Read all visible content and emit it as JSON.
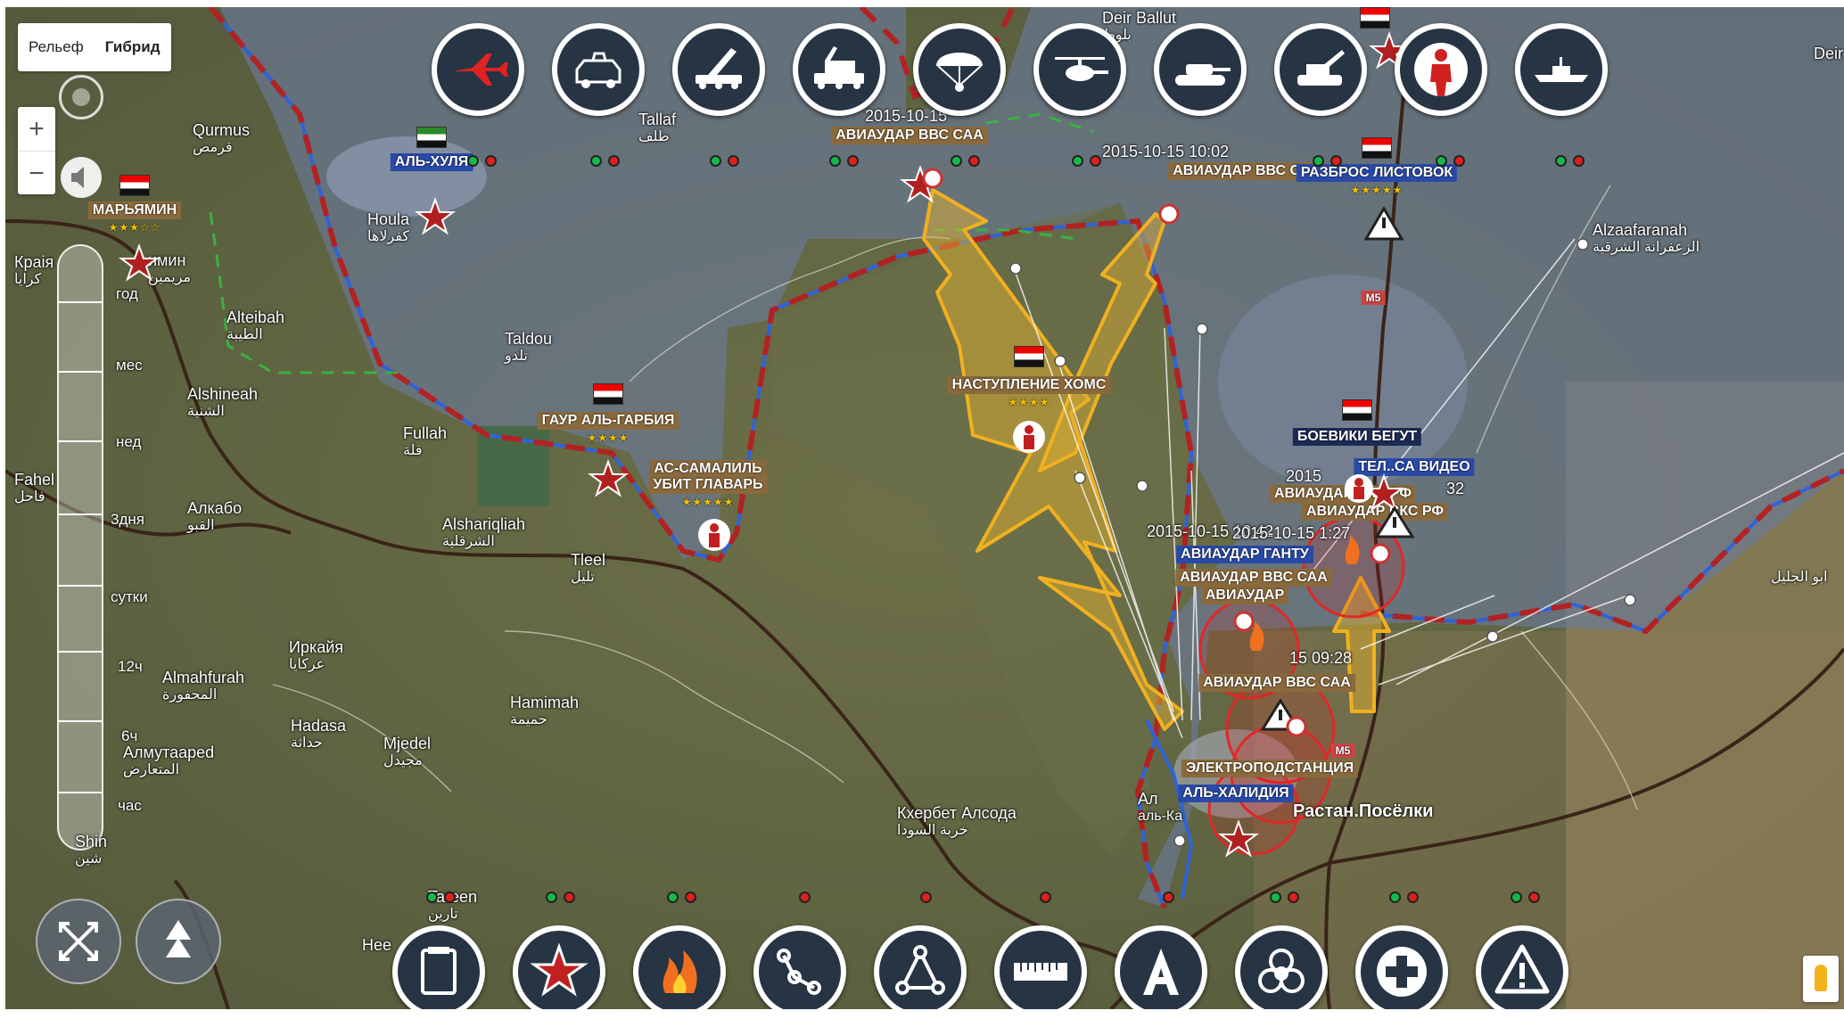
{
  "maptype": {
    "relief": "Рельеф",
    "hybrid": "Гибрид"
  },
  "zoom": {
    "in": "+",
    "out": "−"
  },
  "timeline": {
    "labels": [
      "год",
      "мес",
      "нед",
      "3дня",
      "сутки",
      "12ч",
      "6ч",
      "час"
    ]
  },
  "toolbar_top": [
    "jet-icon",
    "armored-car-icon",
    "rocket-launcher-icon",
    "mlrs-icon",
    "paratrooper-icon",
    "helicopter-icon",
    "tank-icon",
    "artillery-icon",
    "infantry-icon",
    "warship-icon"
  ],
  "toolbar_bottom": [
    "note-icon",
    "star-icon",
    "fire-icon",
    "route-icon",
    "triangle-route-icon",
    "ruler-icon",
    "text-icon",
    "biohazard-icon",
    "medical-cross-icon",
    "warning-icon"
  ],
  "colors": {
    "front_red": "#b22222",
    "front_blue": "#2f63d6",
    "advance": "#f0b020",
    "syria_red": "#e00000",
    "toolbar_bg": "#263444"
  },
  "markers": {
    "marjamin": "МАРЬЯМИН",
    "al_hula": "АЛЬ-ХУЛЯ",
    "gaur": "ГАУР АЛЬ-ГАРБИЯ",
    "samalil": "АС-САМАЛИЛЬ",
    "samalil2": "УБИТ ГЛАВАРЬ",
    "airstrike1": "АВИАУДАР ВВС САА",
    "airstrike2": "АВИАУДАР ВВС САА",
    "offensive": "НАСТУПЛЕНИЕ ХОМС",
    "leaflets": "РАЗБРОС ЛИСТОВОК",
    "fleeing": "БОЕВИКИ БЕГУТ",
    "video": "ТЕЛ..СА ВИДЕО",
    "airstrike_rf": "АВИАУДАР ВКС РФ",
    "airstrike_g": "АВИАУДАР ГАНТУ",
    "airstrike3": "АВИАУДАР ВВС САА",
    "airstrike4": "АВИАУДАР",
    "airstrike5": "АВИАУДАР ВВС САА",
    "power": "ЭЛЕКТРОПОДСТАНЦИЯ",
    "al_khalidiya": "АЛЬ-ХАЛИДИЯ",
    "rastan": "Растан.Посёлки"
  },
  "timestamps": {
    "t1": "2015-10-15",
    "t2": "2015-10-15 10:02",
    "t3": "2015-10-15 10:42",
    "t4": "2015-10-15 1:27",
    "t5": "15 09:28",
    "t6": "2015",
    "t7": "32"
  },
  "places": {
    "qurmus": {
      "lat": "Qurmus",
      "ar": "قرمص"
    },
    "houla": {
      "lat": "Houla",
      "ar": "كفرلاها"
    },
    "taldou": {
      "lat": "Taldou",
      "ar": "تلدو"
    },
    "fullah": {
      "lat": "Fullah",
      "ar": "فلة"
    },
    "alteibah": {
      "lat": "Alteibah",
      "ar": "الطيبة"
    },
    "alshineah": {
      "lat": "Alshineah",
      "ar": "الشنية"
    },
    "alkabo": {
      "lat": "Алкабо",
      "ar": "القبو"
    },
    "alshariqliah": {
      "lat": "Alshariqliah",
      "ar": "الشرقلية"
    },
    "tleel": {
      "lat": "Tleel",
      "ar": "تليل"
    },
    "irkaya": {
      "lat": "Иркайя",
      "ar": "عركايا"
    },
    "almahfurah": {
      "lat": "Almahfurah",
      "ar": "المحفورة"
    },
    "hadasa": {
      "lat": "Hadasa",
      "ar": "حداثة"
    },
    "almutaared": {
      "lat": "Алмутаарed",
      "ar": "المتعارض"
    },
    "mjedel": {
      "lat": "Mjedel",
      "ar": "مجيدل"
    },
    "hamimah": {
      "lat": "Hamimah",
      "ar": "حميمة"
    },
    "kherbet": {
      "lat": "Кхербет Алсода",
      "ar": "خربة السودا"
    },
    "alzaafaranah": {
      "lat": "Alzaafaranah",
      "ar": "الزعفرانة الشرقية"
    },
    "deir_ballut": {
      "lat": "Deir Ballut",
      "ar": "بلوط"
    },
    "talaf": {
      "lat": "Tallaf",
      "ar": "طلف"
    },
    "deir": {
      "lat": "Deir",
      "ar": ""
    },
    "kraya": {
      "lat": "Краія",
      "ar": "كرايا"
    },
    "fahel": {
      "lat": "Fahel",
      "ar": "فاحل"
    },
    "al_jalil": {
      "lat": "",
      "ar": "ابو الجليل"
    },
    "shin": {
      "lat": "Shin",
      "ar": "شين"
    },
    "hees": {
      "lat": "Hee",
      "ar": ""
    },
    "hamin": {
      "lat": "имин",
      "ar": "مريمين"
    },
    "khalidiya_ar": {
      "lat": "Ал",
      "ar": "аль-Ка"
    },
    "thoron": {
      "lat": "Tareen",
      "ar": "تارين"
    },
    "m5a": {
      "lat": "M5",
      "ar": ""
    },
    "m5b": {
      "lat": "M5",
      "ar": ""
    }
  }
}
